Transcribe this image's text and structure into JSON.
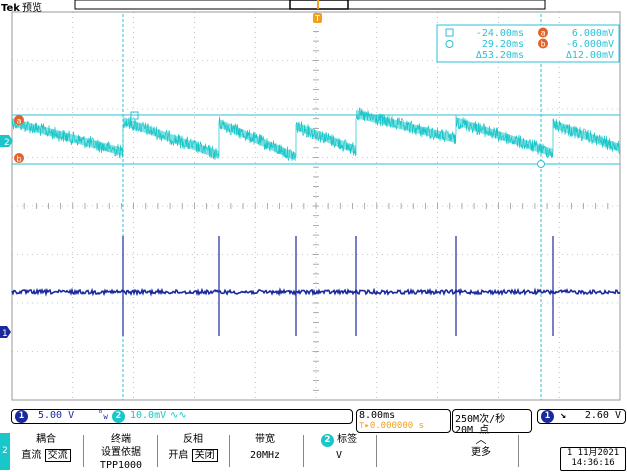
{
  "header": {
    "brand": "Tek",
    "mode": "预览",
    "trigger_marker": "T"
  },
  "colors": {
    "ch1": "#1a2a9c",
    "ch2": "#19c6c9",
    "cursor": "#2bc1d6",
    "cursor_badge": "#e2632a",
    "grid": "#9a9a9a",
    "trigger": "#f0a020"
  },
  "cursor_readout": {
    "t1": "-24.00ms",
    "t2": "29.20ms",
    "dt": "Δ53.20ms",
    "a_badge": "a",
    "a_value": "6.000mV",
    "b_badge": "b",
    "b_value": "-6.000mV",
    "dv": "Δ12.00mV"
  },
  "channel_markers": {
    "ch2": "2",
    "ch1": "1",
    "cursor_a": "a",
    "cursor_b": "b"
  },
  "status": {
    "ch1_num": "1",
    "ch1_scale": "5.00 V",
    "ch1_bw_icon": "bandwidth-icon",
    "ch2_num": "2",
    "ch2_scale": "10.0mV",
    "ch2_bw_icon": "wave-icon",
    "timebase": "8.00ms",
    "trigger_pos": "0.000000 s",
    "sample_rate": "250M次/秒",
    "record_length": "20M 点",
    "trig_source": "1",
    "trig_slope_icon": "falling-edge-icon",
    "trig_level": "2.60 V"
  },
  "menu": {
    "channel_num": "2",
    "coupling_label": "耦合",
    "coupling_dc": "直流",
    "coupling_ac": "交流",
    "termination_label": "终端",
    "termination_sub": "设置依据",
    "termination_value": "TPP1000",
    "invert_label": "反相",
    "invert_on": "开启",
    "invert_off": "关闭",
    "bandwidth_label": "带宽",
    "bandwidth_value": "20MHz",
    "label_num": "2",
    "label_label": "标签",
    "label_value": "V",
    "more_icon": "up-arrow-icon",
    "more_label": "更多",
    "date": "1 11月2021",
    "time": "14:36:16"
  }
}
